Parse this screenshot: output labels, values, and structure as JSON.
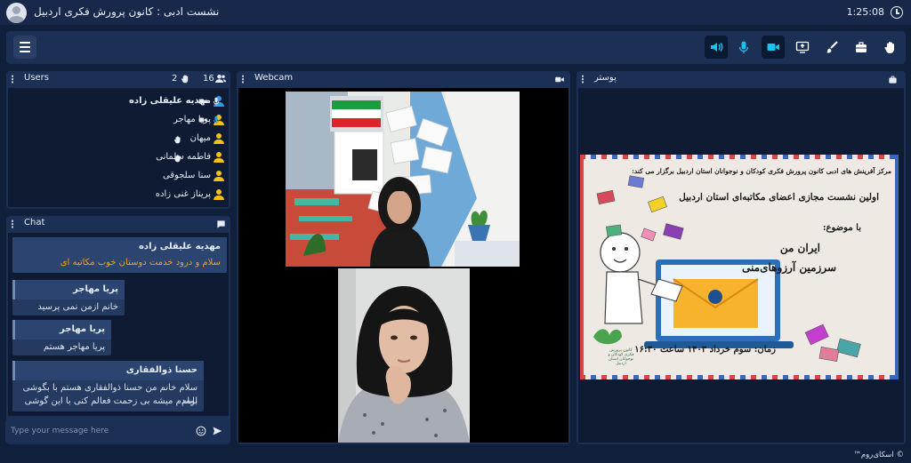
{
  "header": {
    "room_title": "نشست ادبی : کانون پرورش فکری اردبیل",
    "timer": "1:25:08"
  },
  "toolbar": {
    "menu_icon": "hamburger-icon",
    "tools": [
      {
        "icon": "speaker-icon",
        "active": true
      },
      {
        "icon": "microphone-icon",
        "active": false
      },
      {
        "icon": "camera-icon",
        "active": true
      },
      {
        "icon": "screen-share-icon",
        "active": false
      },
      {
        "icon": "brush-icon",
        "active": false
      },
      {
        "icon": "briefcase-icon",
        "active": false
      },
      {
        "icon": "raise-hand-icon",
        "active": false
      }
    ],
    "accent_color": "#19c2ef"
  },
  "users_panel": {
    "title": "Users",
    "hands_count": "2",
    "users_count": "16",
    "users": [
      {
        "name": "مهدیه علیقلی زاده",
        "bold": true,
        "role_color": "#2f9cf0",
        "camera": true,
        "mic": "white",
        "hand": false
      },
      {
        "name": "پریا مهاجر",
        "bold": false,
        "role_color": "#f2c21a",
        "camera": true,
        "mic": "blue",
        "hand": false
      },
      {
        "name": "میهان",
        "bold": false,
        "role_color": "#f2c21a",
        "camera": false,
        "mic": "none",
        "hand": true
      },
      {
        "name": "فاطمه سلمانی",
        "bold": false,
        "role_color": "#f2c21a",
        "camera": false,
        "mic": "none",
        "hand": true
      },
      {
        "name": "سنا سلجوقی",
        "bold": false,
        "role_color": "#f2c21a",
        "camera": false,
        "mic": "none",
        "hand": false
      },
      {
        "name": "پریناز غنی زاده",
        "bold": false,
        "role_color": "#f2c21a",
        "camera": false,
        "mic": "none",
        "hand": false
      }
    ]
  },
  "chat_panel": {
    "title": "Chat",
    "messages": [
      {
        "sender": "مهدیه علیقلی زاده",
        "lines": [
          "سلام و درود خدمت دوستان خوب مکاتبه ای"
        ],
        "highlight": true
      },
      {
        "sender": "پریا مهاجر",
        "lines": [
          "خانم ازمن نمی پرسید"
        ],
        "highlight": false
      },
      {
        "sender": "پریا مهاجر",
        "lines": [
          "پریا مهاجر   هستم"
        ],
        "highlight": false
      },
      {
        "sender": "حسنا ذوالفقاری",
        "lines": [
          "سلام خانم من حسنا ذوالفقاری هستم با بگوشی بابام",
          "اومدم میشه بی زحمت فعالم کنی با این گوشی"
        ],
        "highlight": false
      }
    ],
    "input_placeholder": "Type your message here",
    "emoji_icon": "emoji-icon",
    "send_icon": "send-icon"
  },
  "webcam_panel": {
    "title": "Webcam"
  },
  "poster_panel": {
    "title": "پوستر",
    "poster": {
      "line1": "مرکز آفرینش های ادبی کانون پرورش فکری کودکان و نوجوانان استان اردبیل برگزار می کند:",
      "line2": "اولین نشست مجازی اعضای مکاتبه‌ای استان اردبیل",
      "line3": "با موضوع:",
      "line4": "ایران من",
      "line5": "سرزمین آرزوهای‌منی",
      "line6": "زمان: سوم خرداد ۱۴۰۳    ساعت ۱۶:۳۰",
      "logo_caption": "کانون پرورش فکری کودکان و نوجوانان استان اردبیل",
      "classroom_sign": "سرزمین آرزوهای منی"
    }
  },
  "footer": {
    "brand": "© اسکای‌روم™"
  }
}
